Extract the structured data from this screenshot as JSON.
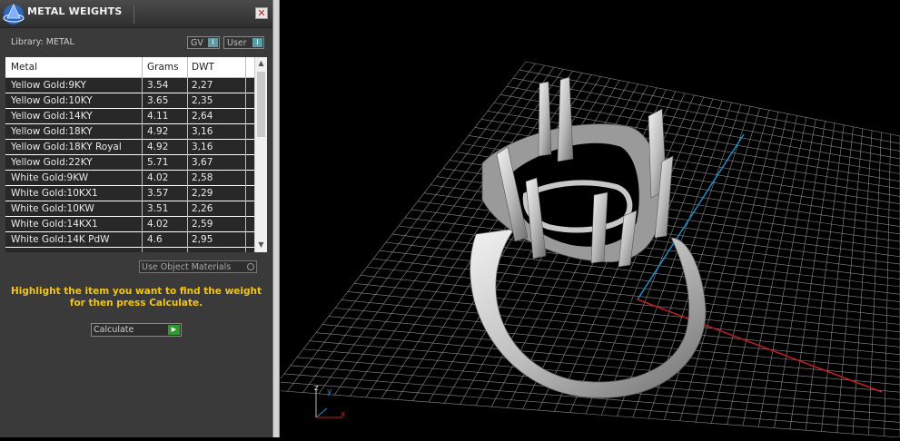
{
  "panel": {
    "title": "METAL WEIGHTS",
    "close_glyph": "✕",
    "library_label": "Library: METAL",
    "gv_label": "GV",
    "user_label": "User",
    "toggle_glyph": "I",
    "use_object_materials": "Use Object Materials",
    "instruction": "Highlight the item you want to find the weight for then press Calculate.",
    "calculate_label": "Calculate",
    "calculate_glyph": "▶"
  },
  "table": {
    "headers": [
      "Metal",
      "Grams",
      "DWT"
    ],
    "rows": [
      {
        "metal": "Yellow Gold:9KY",
        "grams": "3.54",
        "dwt": "2,27"
      },
      {
        "metal": "Yellow Gold:10KY",
        "grams": "3.65",
        "dwt": "2,35"
      },
      {
        "metal": "Yellow Gold:14KY",
        "grams": "4.11",
        "dwt": "2,64"
      },
      {
        "metal": "Yellow Gold:18KY",
        "grams": "4.92",
        "dwt": "3,16"
      },
      {
        "metal": "Yellow Gold:18KY Royal",
        "grams": "4.92",
        "dwt": "3,16"
      },
      {
        "metal": "Yellow Gold:22KY",
        "grams": "5.71",
        "dwt": "3,67"
      },
      {
        "metal": "White Gold:9KW",
        "grams": "4.02",
        "dwt": "2,58"
      },
      {
        "metal": "White Gold:10KX1",
        "grams": "3.57",
        "dwt": "2,29"
      },
      {
        "metal": "White Gold:10KW",
        "grams": "3.51",
        "dwt": "2,26"
      },
      {
        "metal": "White Gold:14KX1",
        "grams": "4.02",
        "dwt": "2,59"
      },
      {
        "metal": "White Gold:14K PdW",
        "grams": "4.6",
        "dwt": "2,95"
      }
    ],
    "scroll_up": "▲",
    "scroll_down": "▼"
  },
  "viewport": {
    "axis_x": "x",
    "axis_y": "y",
    "axis_z": "z",
    "colors": {
      "grid": "#8a8a8a",
      "x_axis": "#c81e1e",
      "y_axis": "#1e8fc8",
      "ring": "#cfcfcf"
    }
  }
}
